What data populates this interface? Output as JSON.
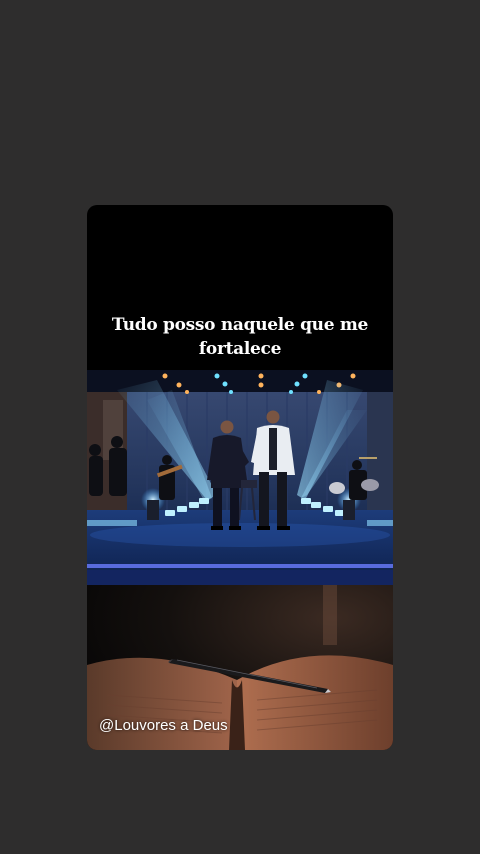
{
  "story": {
    "caption": "Tudo posso naquele que me fortalece",
    "watermark": "@Louvores a Deus"
  },
  "colors": {
    "page_background": "#2e2d2d",
    "stage_light": "#3aa6ff",
    "book_cover": "#8a4a2e"
  },
  "icons": [
    "pen-icon"
  ]
}
